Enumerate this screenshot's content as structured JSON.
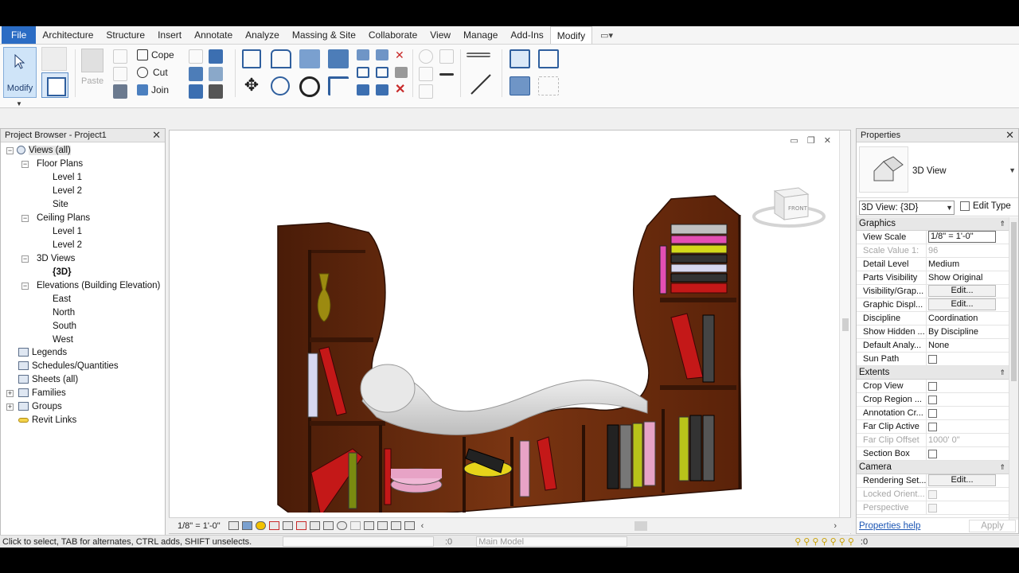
{
  "menu": {
    "file": "File",
    "tabs": [
      "Architecture",
      "Structure",
      "Insert",
      "Annotate",
      "Analyze",
      "Massing & Site",
      "Collaborate",
      "View",
      "Manage",
      "Add-Ins",
      "Modify"
    ],
    "active": "Modify"
  },
  "ribbon": {
    "modify_label": "Modify",
    "paste_label": "Paste",
    "cope_label": "Cope",
    "cut_label": "Cut",
    "join_label": "Join"
  },
  "browser": {
    "title": "Project Browser - Project1",
    "views_all": "Views (all)",
    "floor_plans": "Floor Plans",
    "fp_level1": "Level 1",
    "fp_level2": "Level 2",
    "fp_site": "Site",
    "ceiling_plans": "Ceiling Plans",
    "cp_level1": "Level 1",
    "cp_level2": "Level 2",
    "views3d": "3D Views",
    "view3d": "{3D}",
    "elevations": "Elevations (Building Elevation)",
    "east": "East",
    "north": "North",
    "south": "South",
    "west": "West",
    "legends": "Legends",
    "schedules": "Schedules/Quantities",
    "sheets": "Sheets (all)",
    "families": "Families",
    "groups": "Groups",
    "revit_links": "Revit Links"
  },
  "viewport": {
    "viewcube_label": "FRONT",
    "scale": "1/8\" = 1'-0\""
  },
  "properties": {
    "title": "Properties",
    "type_name": "3D View",
    "instance": "3D View: {3D}",
    "edit_type": "Edit Type",
    "graphics": "Graphics",
    "rows_graphics": [
      {
        "k": "View Scale",
        "v": "1/8\" = 1'-0\""
      },
      {
        "k": "Scale Value    1:",
        "v": "96"
      },
      {
        "k": "Detail Level",
        "v": "Medium"
      },
      {
        "k": "Parts Visibility",
        "v": "Show Original"
      },
      {
        "k": "Visibility/Grap...",
        "v": "Edit..."
      },
      {
        "k": "Graphic Displ...",
        "v": "Edit..."
      },
      {
        "k": "Discipline",
        "v": "Coordination"
      },
      {
        "k": "Show Hidden ...",
        "v": "By Discipline"
      },
      {
        "k": "Default Analy...",
        "v": "None"
      },
      {
        "k": "Sun Path",
        "v": ""
      }
    ],
    "extents": "Extents",
    "rows_extents": [
      {
        "k": "Crop View",
        "v": ""
      },
      {
        "k": "Crop Region ...",
        "v": ""
      },
      {
        "k": "Annotation Cr...",
        "v": ""
      },
      {
        "k": "Far Clip Active",
        "v": ""
      },
      {
        "k": "Far Clip Offset",
        "v": "1000'  0\""
      },
      {
        "k": "Section Box",
        "v": ""
      }
    ],
    "camera": "Camera",
    "rows_camera": [
      {
        "k": "Rendering Set...",
        "v": "Edit..."
      },
      {
        "k": "Locked Orient...",
        "v": ""
      },
      {
        "k": "Perspective",
        "v": ""
      }
    ],
    "help": "Properties help",
    "apply": "Apply"
  },
  "status": {
    "message": "Click to select, TAB for alternates, CTRL adds, SHIFT unselects.",
    "workset": ":0",
    "model": "Main Model",
    "filter": ":0"
  }
}
